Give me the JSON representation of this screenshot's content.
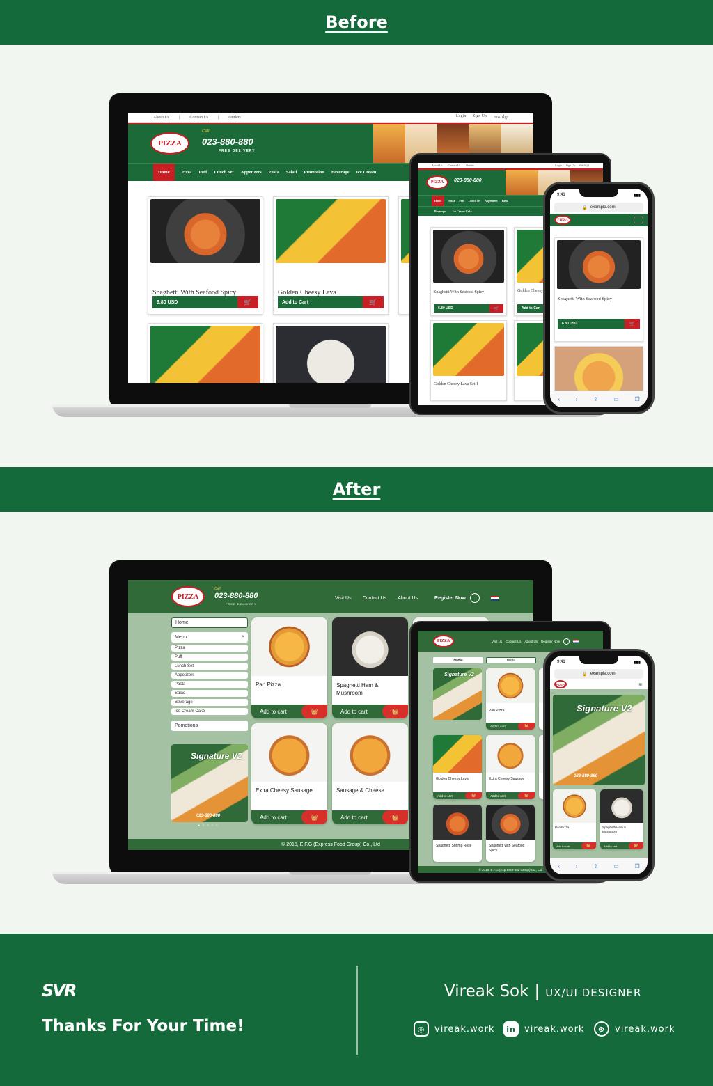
{
  "sections": {
    "before": "Before",
    "after": "After"
  },
  "old_site": {
    "top_links": [
      "About Us",
      "|",
      "Contact Us",
      "|",
      "Outlets"
    ],
    "top_right": [
      "Login",
      "Sign Up",
      "ភាសាខ្មែរ"
    ],
    "logo_text": "PIZZA",
    "call_label": "Call",
    "phone": "023-880-880",
    "free_delivery": "FREE DELIVERY",
    "nav": [
      "Home",
      "Pizza",
      "Puff",
      "Lunch Set",
      "Appetizers",
      "Pasta",
      "Salad",
      "Promotion",
      "Beverage",
      "Ice Cream"
    ],
    "cards": [
      {
        "title": "Spaghetti With Seafood Spicy",
        "button": "6.80 USD"
      },
      {
        "title": "Golden Cheesy Lava",
        "button": "Add to Cart"
      }
    ],
    "tablet_nav2": [
      "Beverage",
      "Ice Cream Cake"
    ],
    "tablet_cards": [
      {
        "title": "Spaghetti With Seafood Spicy",
        "button": "6.80 USD"
      },
      {
        "title": "Golden Cheesy Lava",
        "button": "Add to Cart"
      },
      {
        "title": "Golden Cheesy Lava Set 1"
      }
    ],
    "phone_time": "9:41",
    "phone_url": "example.com",
    "phone_card": {
      "title": "Spaghetti With Seafood Spicy",
      "button": "6.80 USD"
    }
  },
  "new_site": {
    "call_label": "Call",
    "phone": "023-880-880",
    "free_delivery": "FREE DELIVERY",
    "nav": [
      "Visit Us",
      "Contact Us",
      "About Us"
    ],
    "register": "Register Now",
    "sidebar": {
      "home": "Home",
      "menu": "Menu",
      "items": [
        "Pizza",
        "Puff",
        "Lunch Set",
        "Appetizers",
        "Pasta",
        "Salad",
        "Beverage",
        "Ice Cream Cake"
      ],
      "promotions": "Pomotions"
    },
    "banner": {
      "title": "Signature",
      "version": "V2",
      "phone": "023-880-880"
    },
    "cards": [
      {
        "title": "Pan Pizza",
        "button": "Add to cart"
      },
      {
        "title": "Spaghetti Ham & Mushroom",
        "button": "Add to cart"
      },
      {
        "title": "Extra Cheesy Sausage",
        "button": "Add to cart"
      },
      {
        "title": "Sausage & Cheese",
        "button": "Add to cart"
      }
    ],
    "footer": "© 2015, E.F.G (Express Food Group) Co., Ltd",
    "tablet_tabs": [
      "Home",
      "Menu"
    ],
    "tablet_cards": [
      {
        "title": "Pan Pizza",
        "button": "Add to cart"
      },
      {
        "title": "Golden Cheesy Lava",
        "button": "Add to cart"
      },
      {
        "title": "Extra Cheesy Sausage",
        "button": "Add to cart"
      },
      {
        "title": "Spaghetti Shrimp Rose"
      },
      {
        "title": "Spaghetti with Seafood Spicy"
      }
    ],
    "tablet_footer": "© 2015, E.F.G (Express Food Group) Co., Ltd",
    "phone_time": "9:41",
    "phone_url": "example.com",
    "phone_cards": [
      {
        "title": "Pan Pizza",
        "button": "Add to cart"
      },
      {
        "title": "Spaghetti Ham & Mushroom",
        "button": "Add to cart"
      }
    ]
  },
  "footer": {
    "logo": "SVR",
    "thanks": "Thanks For Your Time!",
    "name": "Vireak Sok",
    "separator": "|",
    "role": "UX/UI DESIGNER",
    "socials": [
      {
        "icon": "instagram-icon",
        "handle": "vireak.work"
      },
      {
        "icon": "linkedin-icon",
        "handle": "vireak.work"
      },
      {
        "icon": "dribbble-icon",
        "handle": "vireak.work"
      }
    ]
  },
  "colors": {
    "brand_green": "#146a3a",
    "site_green": "#1b6a37",
    "new_green": "#2f6a38",
    "accent_red": "#c81f25",
    "sage": "#a4c2a3"
  }
}
